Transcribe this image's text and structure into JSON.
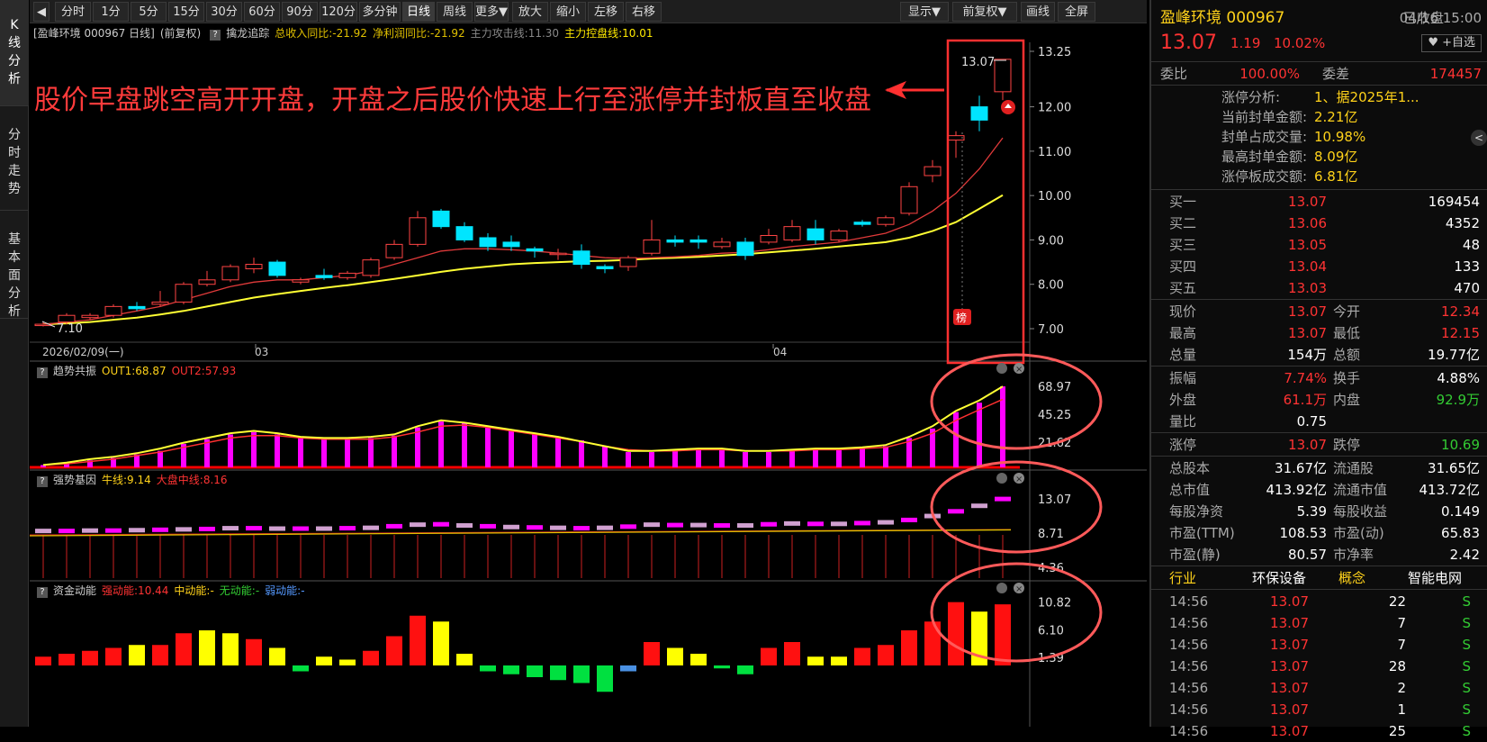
{
  "sidetabs": [
    {
      "label": "K线分析"
    },
    {
      "label": "分时走势"
    },
    {
      "label": "基本面分析"
    }
  ],
  "toolbar": {
    "collapse_icon": "◀",
    "periods": [
      "分时",
      "1分",
      "5分",
      "15分",
      "30分",
      "60分",
      "90分",
      "120分",
      "多分钟",
      "日线",
      "周线",
      "更多▼"
    ],
    "active": "日线",
    "actions": [
      "放大",
      "缩小",
      "左移",
      "右移"
    ],
    "right": [
      "显示▼",
      "前复权▼",
      "画线",
      "全屏"
    ]
  },
  "main_title": {
    "stock": "[盈峰环境 000967 日线]",
    "adj": "(前复权)",
    "qm": "?",
    "name": "擒龙追踪",
    "f1": "总收入同比:-21.92",
    "f2": "净利润同比:-21.92",
    "f3": "主力攻击线:11.30",
    "f4": "主力控盘线:10.01"
  },
  "annotation": "股价早盘跳空高开开盘，开盘之后股价快速上行至涨停并封板直至收盘",
  "axis": {
    "main_ticks": [
      "13.25",
      "12.00",
      "11.00",
      "10.00",
      "9.00",
      "8.00",
      "7.00"
    ],
    "date_start": "2026/02/09(一)",
    "month1": "03",
    "month2": "04",
    "low_label": "7.10",
    "high_label": "13.07",
    "bang": "榜"
  },
  "ind1": {
    "qm": "?",
    "name": "趋势共振",
    "out1": "OUT1:68.87",
    "out2": "OUT2:57.93",
    "ticks": [
      "68.97",
      "45.25",
      "21.62"
    ]
  },
  "ind2": {
    "qm": "?",
    "name": "强势基因",
    "bull": "牛线:9.14",
    "bear": "大盘中线:8.16",
    "ticks": [
      "13.07",
      "8.71",
      "4.36"
    ]
  },
  "ind3": {
    "qm": "?",
    "name": "资金动能",
    "strong": "强动能:10.44",
    "mid": "中动能:-",
    "none": "无动能:-",
    "weak": "弱动能:-",
    "ticks": [
      "10.82",
      "6.10",
      "1.39"
    ]
  },
  "chart_data": {
    "type": "candlestick",
    "ylim": [
      6.8,
      13.5
    ],
    "candles": [
      [
        7.1,
        7.15,
        7.05,
        7.1
      ],
      [
        7.15,
        7.35,
        7.1,
        7.3
      ],
      [
        7.25,
        7.35,
        7.2,
        7.3
      ],
      [
        7.3,
        7.55,
        7.25,
        7.5
      ],
      [
        7.5,
        7.6,
        7.4,
        7.45
      ],
      [
        7.55,
        7.85,
        7.5,
        7.6
      ],
      [
        7.6,
        8.05,
        7.55,
        8.0
      ],
      [
        8.0,
        8.3,
        7.95,
        8.1
      ],
      [
        8.1,
        8.45,
        8.05,
        8.4
      ],
      [
        8.35,
        8.6,
        8.25,
        8.45
      ],
      [
        8.5,
        8.55,
        8.15,
        8.2
      ],
      [
        8.05,
        8.15,
        8.0,
        8.1
      ],
      [
        8.2,
        8.35,
        8.1,
        8.15
      ],
      [
        8.15,
        8.3,
        8.1,
        8.25
      ],
      [
        8.2,
        8.6,
        8.15,
        8.55
      ],
      [
        8.6,
        9.0,
        8.55,
        8.9
      ],
      [
        8.9,
        9.65,
        8.85,
        9.5
      ],
      [
        9.65,
        9.7,
        9.25,
        9.3
      ],
      [
        9.3,
        9.4,
        8.95,
        9.0
      ],
      [
        9.05,
        9.15,
        8.75,
        8.85
      ],
      [
        8.95,
        9.1,
        8.75,
        8.85
      ],
      [
        8.8,
        8.85,
        8.6,
        8.75
      ],
      [
        8.7,
        8.8,
        8.55,
        8.7
      ],
      [
        8.75,
        8.9,
        8.35,
        8.45
      ],
      [
        8.4,
        8.45,
        8.25,
        8.35
      ],
      [
        8.4,
        8.65,
        8.3,
        8.6
      ],
      [
        8.7,
        9.45,
        8.65,
        9.0
      ],
      [
        9.0,
        9.1,
        8.85,
        8.95
      ],
      [
        9.0,
        9.1,
        8.8,
        8.95
      ],
      [
        8.85,
        9.05,
        8.8,
        8.95
      ],
      [
        8.95,
        9.05,
        8.55,
        8.65
      ],
      [
        8.95,
        9.25,
        8.9,
        9.1
      ],
      [
        9.0,
        9.45,
        8.95,
        9.3
      ],
      [
        9.25,
        9.45,
        8.9,
        9.0
      ],
      [
        9.0,
        9.25,
        8.95,
        9.2
      ],
      [
        9.4,
        9.45,
        9.3,
        9.35
      ],
      [
        9.35,
        9.55,
        9.3,
        9.5
      ],
      [
        9.6,
        10.3,
        9.55,
        10.2
      ],
      [
        10.45,
        10.8,
        10.3,
        10.65
      ],
      [
        11.25,
        11.45,
        10.85,
        11.35
      ],
      [
        12.0,
        12.25,
        11.45,
        11.7
      ],
      [
        12.34,
        13.07,
        12.15,
        13.07
      ]
    ],
    "ma_red": [
      7.1,
      7.15,
      7.2,
      7.3,
      7.4,
      7.5,
      7.65,
      7.8,
      7.95,
      8.05,
      8.1,
      8.1,
      8.15,
      8.2,
      8.3,
      8.45,
      8.6,
      8.75,
      8.8,
      8.8,
      8.78,
      8.75,
      8.7,
      8.65,
      8.6,
      8.58,
      8.6,
      8.62,
      8.65,
      8.7,
      8.72,
      8.78,
      8.85,
      8.9,
      8.95,
      9.05,
      9.15,
      9.35,
      9.65,
      10.05,
      10.6,
      11.3
    ],
    "ma_yellow": [
      7.1,
      7.12,
      7.15,
      7.2,
      7.25,
      7.32,
      7.4,
      7.5,
      7.6,
      7.7,
      7.78,
      7.85,
      7.92,
      7.98,
      8.05,
      8.12,
      8.2,
      8.28,
      8.35,
      8.4,
      8.45,
      8.48,
      8.5,
      8.52,
      8.53,
      8.55,
      8.58,
      8.6,
      8.62,
      8.65,
      8.68,
      8.72,
      8.76,
      8.8,
      8.85,
      8.9,
      8.95,
      9.05,
      9.2,
      9.4,
      9.7,
      10.01
    ],
    "ind1_bars": [
      2,
      4,
      6,
      8,
      11,
      14,
      20,
      24,
      28,
      30,
      28,
      25,
      24,
      24,
      25,
      27,
      34,
      39,
      38,
      35,
      32,
      29,
      26,
      23,
      18,
      13,
      13,
      14,
      15,
      15,
      13,
      13,
      14,
      15,
      15,
      16,
      18,
      25,
      33,
      47,
      55,
      68.87
    ],
    "ind1_out1": [
      2,
      4,
      7,
      9,
      12,
      16,
      21,
      25,
      29,
      31,
      29,
      26,
      25,
      25,
      26,
      28,
      35,
      40,
      38,
      35,
      32,
      29,
      26,
      22,
      18,
      14,
      14,
      15,
      16,
      16,
      14,
      14,
      15,
      16,
      16,
      17,
      19,
      26,
      35,
      48,
      57,
      68.87
    ],
    "ind1_out2": [
      2,
      3,
      5,
      7,
      10,
      13,
      17,
      21,
      25,
      27,
      27,
      25,
      24,
      24,
      24,
      26,
      30,
      35,
      36,
      34,
      31,
      28,
      25,
      22,
      18,
      15,
      14,
      14,
      15,
      15,
      14,
      14,
      14,
      15,
      15,
      16,
      17,
      22,
      29,
      40,
      49,
      57.93
    ],
    "ind2_bars": [
      9.0,
      9.0,
      9.05,
      9.05,
      9.1,
      9.15,
      9.2,
      9.25,
      9.35,
      9.35,
      9.3,
      9.3,
      9.3,
      9.35,
      9.4,
      9.6,
      9.8,
      9.85,
      9.7,
      9.6,
      9.5,
      9.45,
      9.4,
      9.35,
      9.4,
      9.55,
      9.8,
      9.75,
      9.75,
      9.7,
      9.7,
      9.85,
      9.95,
      9.9,
      9.9,
      10.0,
      10.1,
      10.4,
      10.9,
      11.5,
      12.2,
      13.07
    ],
    "ind3_vals": [
      1.5,
      2,
      2.5,
      3,
      3.5,
      3.5,
      5.5,
      6,
      5.5,
      4.5,
      3,
      -1,
      1.5,
      1,
      2.5,
      5,
      8.5,
      7.5,
      2,
      -1,
      -1.5,
      -2,
      -2.5,
      -3,
      -4.5,
      -1,
      4,
      3,
      2,
      -0.5,
      -1.5,
      3,
      4,
      1.5,
      1.5,
      3,
      3.5,
      6,
      7.5,
      10.82,
      9.2,
      10.44
    ],
    "ind3_colors": [
      "r",
      "r",
      "r",
      "r",
      "y",
      "r",
      "r",
      "y",
      "y",
      "r",
      "y",
      "g",
      "y",
      "y",
      "r",
      "r",
      "r",
      "y",
      "y",
      "g",
      "g",
      "g",
      "g",
      "g",
      "g",
      "b",
      "r",
      "y",
      "y",
      "g",
      "g",
      "r",
      "r",
      "y",
      "y",
      "r",
      "r",
      "r",
      "r",
      "r",
      "y",
      "r"
    ]
  },
  "panel": {
    "name": "盈峰环境",
    "code": "000967",
    "status": "已收盘",
    "date": "04/16 15:00",
    "price": "13.07",
    "change": "1.19",
    "pct": "10.02%",
    "fav": "+自选",
    "weibi_l": "委比",
    "weibi_v": "100.00%",
    "weicha_l": "委差",
    "weicha_v": "174457",
    "zt": [
      [
        "涨停分析:",
        "1、据2025年1..."
      ],
      [
        "当前封单金额:",
        "2.21亿"
      ],
      [
        "封单占成交量:",
        "10.98%"
      ],
      [
        "最高封单金额:",
        "8.09亿"
      ],
      [
        "涨停板成交额:",
        "6.81亿"
      ]
    ],
    "buys": [
      [
        "买一",
        "13.07",
        "169454"
      ],
      [
        "买二",
        "13.06",
        "4352"
      ],
      [
        "买三",
        "13.05",
        "48"
      ],
      [
        "买四",
        "13.04",
        "133"
      ],
      [
        "买五",
        "13.03",
        "470"
      ]
    ],
    "quote": [
      [
        "现价",
        "13.07",
        "今开",
        "12.34"
      ],
      [
        "最高",
        "13.07",
        "最低",
        "12.15"
      ],
      [
        "总量",
        "154万",
        "总额",
        "19.77亿"
      ]
    ],
    "quote2": [
      [
        "振幅",
        "7.74%",
        "换手",
        "4.88%"
      ],
      [
        "外盘",
        "61.1万",
        "内盘",
        "92.9万"
      ],
      [
        "量比",
        "0.75",
        "",
        ""
      ]
    ],
    "limit": [
      [
        "涨停",
        "13.07",
        "跌停",
        "10.69"
      ]
    ],
    "fund": [
      [
        "总股本",
        "31.67亿",
        "流通股",
        "31.65亿"
      ],
      [
        "总市值",
        "413.92亿",
        "流通市值",
        "413.72亿"
      ],
      [
        "每股净资",
        "5.39",
        "每股收益",
        "0.149"
      ],
      [
        "市盈(TTM)",
        "108.53",
        "市盈(动)",
        "65.83"
      ],
      [
        "市盈(静)",
        "80.57",
        "市净率",
        "2.42"
      ]
    ],
    "industry": [
      "行业",
      "环保设备",
      "概念",
      "智能电网"
    ],
    "ticks": [
      [
        "14:56",
        "13.07",
        "22",
        "S"
      ],
      [
        "14:56",
        "13.07",
        "7",
        "S"
      ],
      [
        "14:56",
        "13.07",
        "7",
        "S"
      ],
      [
        "14:56",
        "13.07",
        "28",
        "S"
      ],
      [
        "14:56",
        "13.07",
        "2",
        "S"
      ],
      [
        "14:56",
        "13.07",
        "1",
        "S"
      ],
      [
        "14:56",
        "13.07",
        "25",
        "S"
      ]
    ],
    "side_arrow": "<"
  }
}
